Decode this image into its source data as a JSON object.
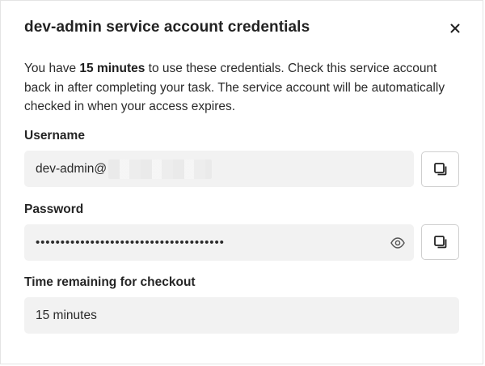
{
  "dialog": {
    "title": "dev-admin service account credentials",
    "close_icon": "close-icon",
    "description": {
      "prefix": "You have ",
      "highlight": "15 minutes",
      "suffix": " to use these credentials. Check this service account back in after completing your task. The service account will be automatically checked in when your access expires."
    }
  },
  "username": {
    "label": "Username",
    "value": "dev-admin@",
    "copy_icon": "copy-icon"
  },
  "password": {
    "label": "Password",
    "value": "••••••••••••••••••••••••••••••••••••••",
    "reveal_icon": "eye-icon",
    "copy_icon": "copy-icon"
  },
  "time_remaining": {
    "label": "Time remaining for checkout",
    "value": "15 minutes"
  }
}
